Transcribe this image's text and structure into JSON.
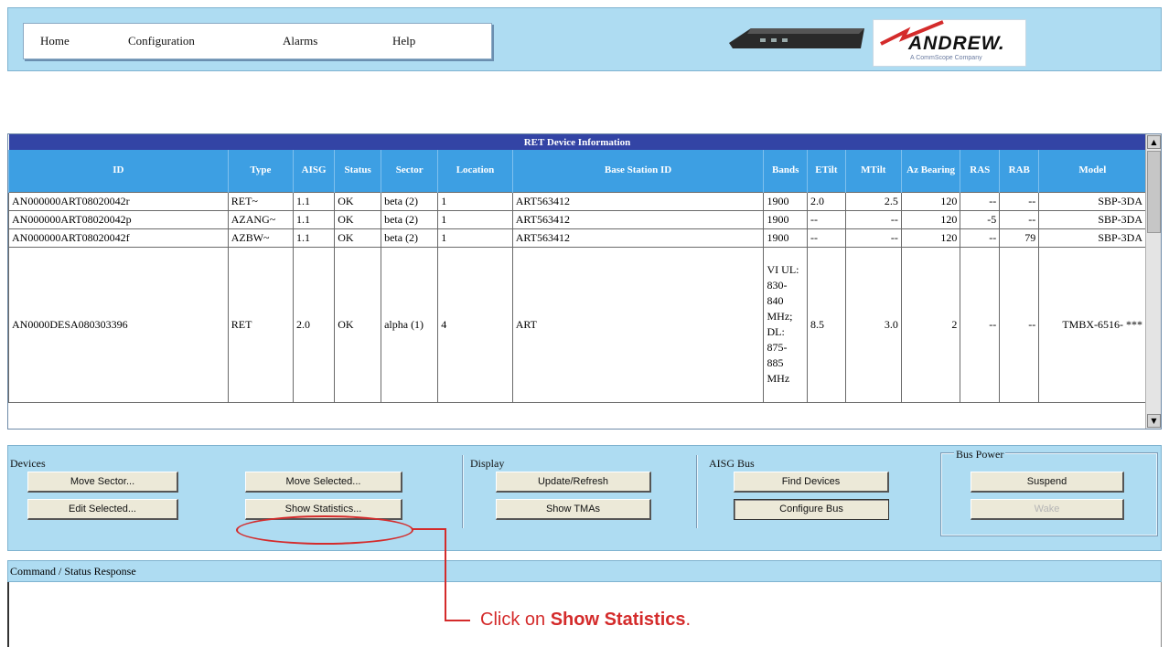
{
  "nav": {
    "items": [
      "Home",
      "Configuration",
      "Alarms",
      "Help"
    ]
  },
  "brand": {
    "name": "ANDREW.",
    "tagline": "A CommScope Company"
  },
  "table": {
    "caption": "RET Device Information",
    "headers": [
      "ID",
      "Type",
      "AISG",
      "Status",
      "Sector",
      "Location",
      "Base Station ID",
      "Bands",
      "ETilt",
      "MTilt",
      "Az Bearing",
      "RAS",
      "RAB",
      "Model"
    ],
    "rows": [
      [
        "AN000000ART08020042r",
        "RET~",
        "1.1",
        "OK",
        "beta (2)",
        "1",
        "ART563412",
        "1900",
        "2.0",
        "2.5",
        "120",
        "--",
        "--",
        "SBP-3DA"
      ],
      [
        "AN000000ART08020042p",
        "AZANG~",
        "1.1",
        "OK",
        "beta (2)",
        "1",
        "ART563412",
        "1900",
        "--",
        "--",
        "120",
        "-5",
        "--",
        "SBP-3DA"
      ],
      [
        "AN000000ART08020042f",
        "AZBW~",
        "1.1",
        "OK",
        "beta (2)",
        "1",
        "ART563412",
        "1900",
        "--",
        "--",
        "120",
        "--",
        "79",
        "SBP-3DA"
      ],
      [
        "AN0000DESA080303396",
        "RET",
        "2.0",
        "OK",
        "alpha (1)",
        "4",
        "ART",
        "VI UL: 830- 840 MHz; DL: 875- 885 MHz",
        "8.5",
        "3.0",
        "2",
        "--",
        "--",
        "TMBX-6516- ***"
      ]
    ]
  },
  "controls": {
    "devices_label": "Devices",
    "display_label": "Display",
    "aisg_label": "AISG Bus",
    "buspower_label": "Bus Power",
    "move_sector": "Move Sector...",
    "move_selected": "Move Selected...",
    "edit_selected": "Edit Selected...",
    "show_statistics": "Show Statistics...",
    "update_refresh": "Update/Refresh",
    "show_tmas": "Show TMAs",
    "find_devices": "Find Devices",
    "configure_bus": "Configure Bus",
    "suspend": "Suspend",
    "wake": "Wake"
  },
  "status": {
    "label": "Command / Status Response",
    "response": ""
  },
  "annotation": {
    "prefix": "Click on ",
    "target": "Show Statistics",
    "suffix": "."
  },
  "colors": {
    "banner_bg": "#aedcf2",
    "table_caption_bg": "#3344a5",
    "table_header_bg": "#3d9fe3",
    "callout": "#d42b2b"
  }
}
